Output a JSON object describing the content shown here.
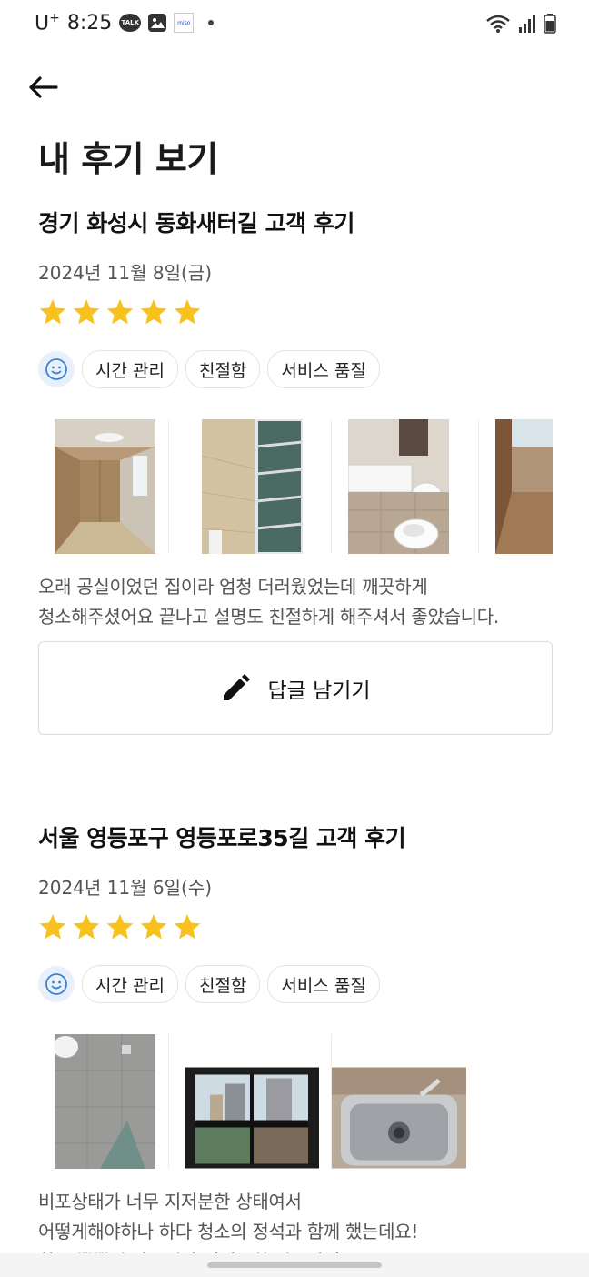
{
  "status_bar": {
    "carrier": "U",
    "carrier_sup": "+",
    "time": "8:25",
    "talk_badge": "TALK",
    "miso_badge": "miso"
  },
  "page": {
    "title": "내 후기 보기"
  },
  "reviews": [
    {
      "title": "경기 화성시 동화새터길 고객 후기",
      "date": "2024년 11월 8일(금)",
      "rating": 5,
      "tags": [
        "시간 관리",
        "친절함",
        "서비스 품질"
      ],
      "photos": [
        "empty-room-photo",
        "balcony-photo",
        "bathroom-photo",
        "hallway-photo"
      ],
      "text_lines": [
        "오래 공실이었던 집이라 엄청 더러웠었는데 깨끗하게",
        "청소해주셨어요 끝나고 설명도 친절하게 해주셔서 좋았습니다."
      ]
    },
    {
      "title": "서울 영등포구 영등포로35길 고객 후기",
      "date": "2024년 11월 6일(수)",
      "rating": 5,
      "tags": [
        "시간 관리",
        "친절함",
        "서비스 품질"
      ],
      "photos": [
        "shower-corner-photo",
        "window-photo",
        "sink-photo"
      ],
      "text_lines": [
        "비포상태가 너무 지저분한 상태여서",
        "어떻게해야하나 하다 청소의 정석과 함께 했는데요!",
        "창문 뿍뿍이 자국이랑 지저분한 것들까지"
      ]
    }
  ],
  "reply_button": {
    "label": "답글 남기기"
  },
  "colors": {
    "star": "#f7c21d",
    "smile_bg": "#e8f1fb",
    "smile_stroke": "#3b82d6"
  }
}
